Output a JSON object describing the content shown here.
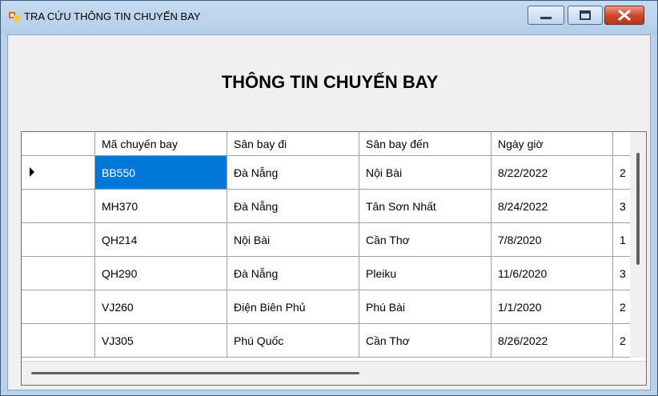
{
  "window": {
    "title": "TRA CỨU THÔNG TIN CHUYẾN BAY",
    "heading": "THÔNG TIN CHUYẾN BAY"
  },
  "icons": {
    "app": "app-icon",
    "minimize": "minimize-icon",
    "maximize": "maximize-icon",
    "close": "close-icon",
    "row_indicator": "current-row-arrow-icon"
  },
  "colors": {
    "selection": "#0078d7",
    "close_button": "#c8452a"
  },
  "grid": {
    "columns": [
      "Mã chuyến bay",
      "Sân bay đi",
      "Sân bay đến",
      "Ngày giờ",
      ""
    ],
    "rows": [
      [
        "BB550",
        "Đà Nẵng",
        "Nội Bài",
        "8/22/2022",
        "2"
      ],
      [
        "MH370",
        "Đà Nẵng",
        "Tân Sơn Nhất",
        "8/24/2022",
        "3"
      ],
      [
        "QH214",
        "Nội Bài",
        "Cần Thơ",
        "7/8/2020",
        "1"
      ],
      [
        "QH290",
        "Đà Nẵng",
        "Pleiku",
        "11/6/2020",
        "3"
      ],
      [
        "VJ260",
        "Điện Biên Phủ",
        "Phú Bài",
        "1/1/2020",
        "2"
      ],
      [
        "VJ305",
        "Phú Quốc",
        "Cần Thơ",
        "8/26/2022",
        "2"
      ]
    ]
  }
}
